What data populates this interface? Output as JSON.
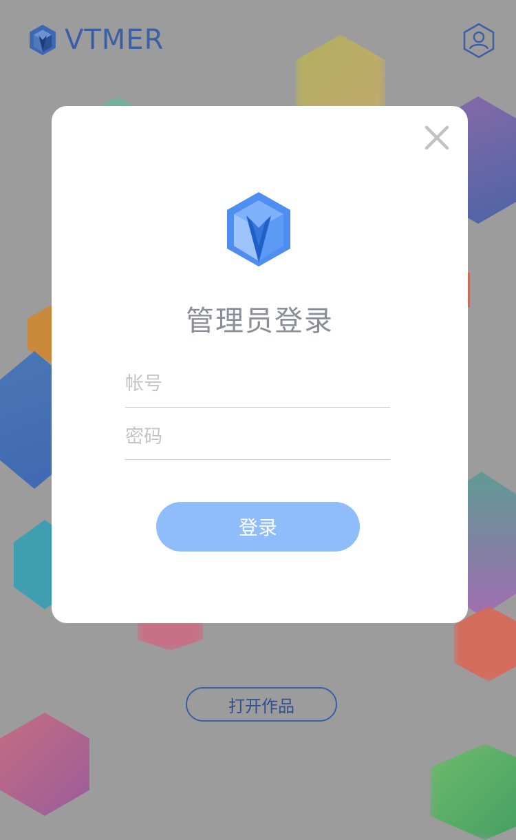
{
  "header": {
    "brand_name": "VTMER",
    "logo_icon": "cube-logo-icon",
    "user_icon": "user-profile-icon"
  },
  "modal": {
    "close_icon": "close-icon",
    "logo_icon": "cube-logo-icon",
    "title": "管理员登录",
    "account_placeholder": "帐号",
    "password_placeholder": "密码",
    "login_label": "登录"
  },
  "footer": {
    "open_work_label": "打开作品"
  },
  "colors": {
    "brand": "#3b5fa3",
    "login_button": "#8fbdfb",
    "overlay": "#9c9c9c"
  }
}
